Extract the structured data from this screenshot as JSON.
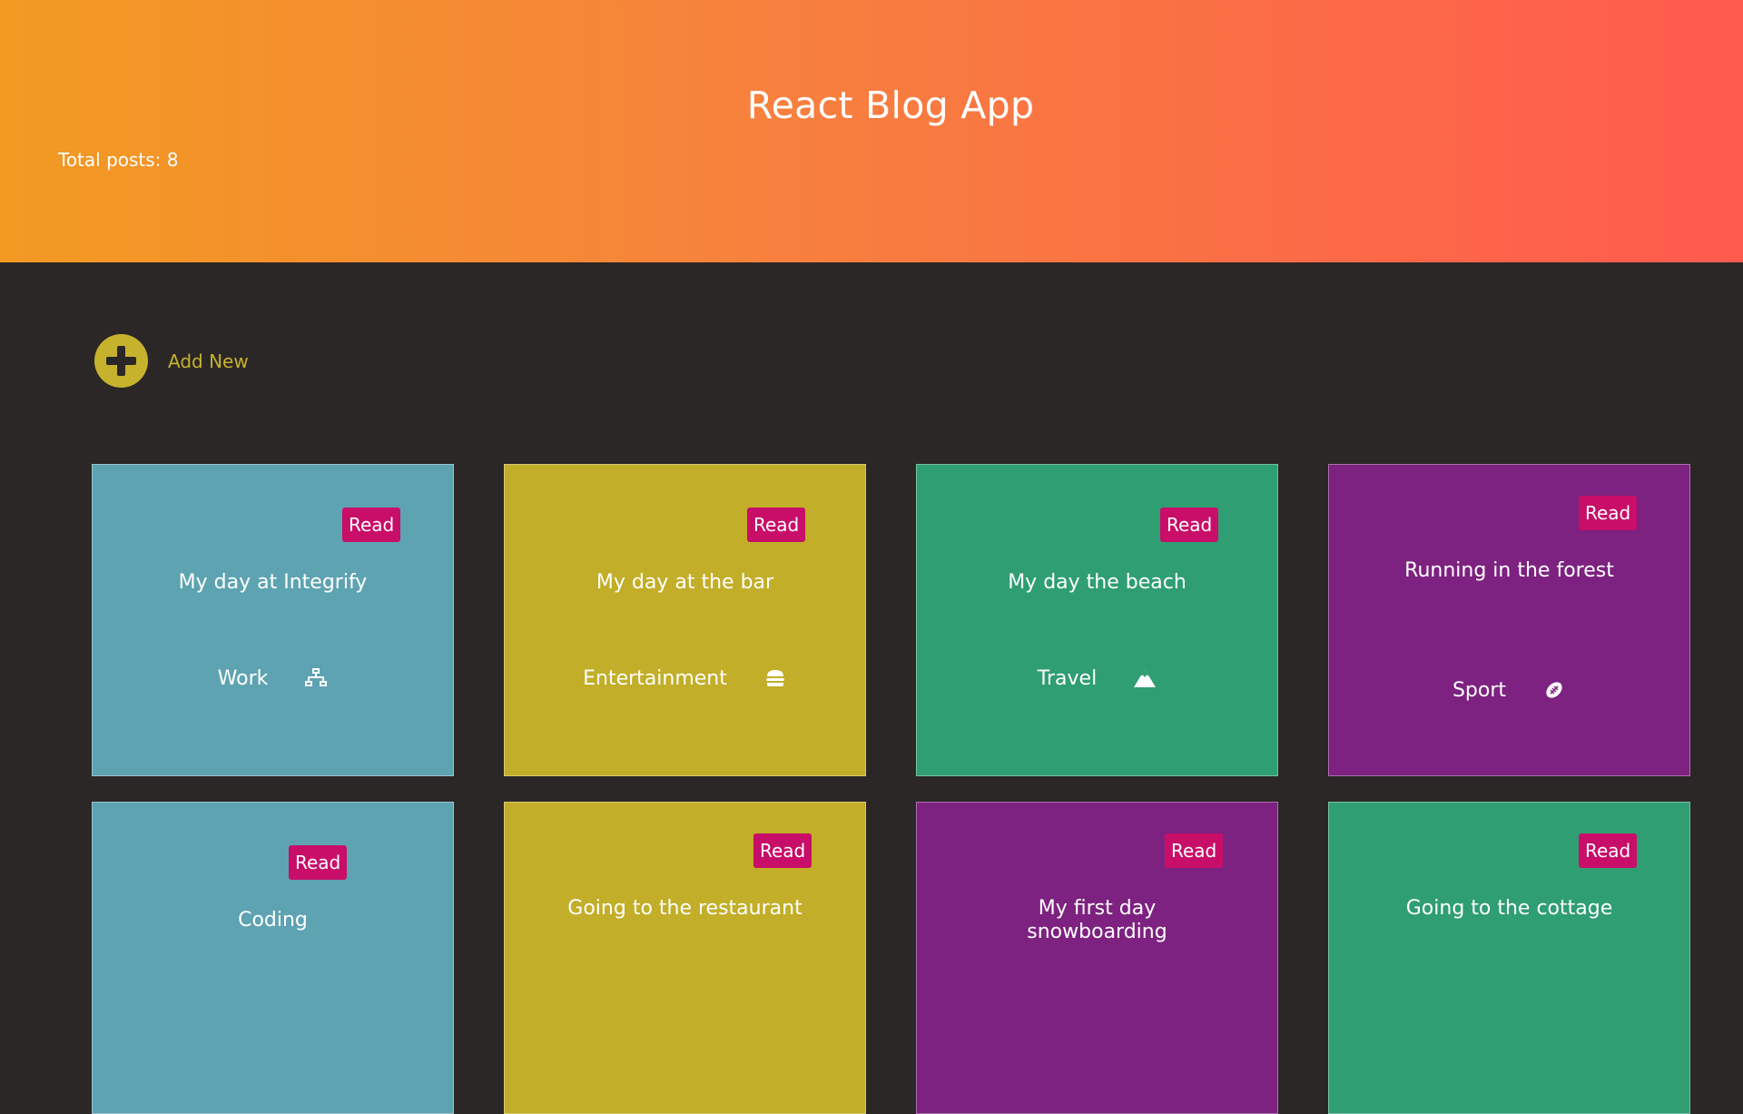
{
  "header": {
    "title": "React Blog App",
    "total_posts": "Total posts: 8"
  },
  "add_new": {
    "label": "Add New"
  },
  "colors": {
    "blue": "#5ea3b1",
    "yellow": "#c2ae28",
    "green": "#2f9e73",
    "purple": "#7d2280",
    "read_button": "#c80e68"
  },
  "posts": [
    {
      "title": "My day at Integrify",
      "category": "Work",
      "icon": "sitemap-icon",
      "color": "blue",
      "read": "Read"
    },
    {
      "title": "My day at the bar",
      "category": "Entertainment",
      "icon": "hamburger-icon",
      "color": "yellow",
      "read": "Read"
    },
    {
      "title": "My day the beach",
      "category": "Travel",
      "icon": "mountain-icon",
      "color": "green",
      "read": "Read"
    },
    {
      "title": "Running in the forest",
      "category": "Sport",
      "icon": "football-icon",
      "color": "purple",
      "read": "Read"
    },
    {
      "title": "Coding",
      "category": "",
      "icon": "",
      "color": "blue",
      "read": "Read"
    },
    {
      "title": "Going to the restaurant",
      "category": "",
      "icon": "",
      "color": "yellow",
      "read": "Read"
    },
    {
      "title": "My first day snowboarding",
      "category": "",
      "icon": "",
      "color": "purple",
      "read": "Read"
    },
    {
      "title": "Going to the cottage",
      "category": "",
      "icon": "",
      "color": "green",
      "read": "Read"
    }
  ]
}
